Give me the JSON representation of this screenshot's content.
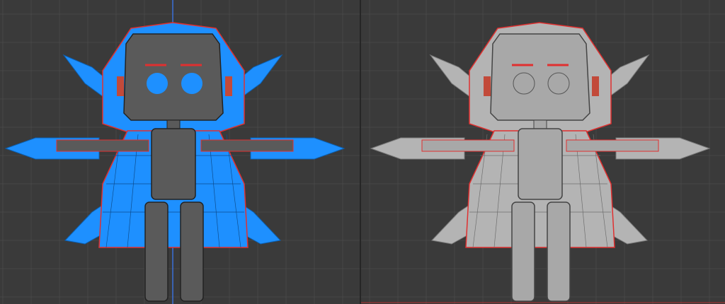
{
  "viewports": [
    {
      "id": "left",
      "shading": "x-ray",
      "fill": "#1e90ff",
      "body_fill": "#5a5a5a",
      "outline": "#e03030"
    },
    {
      "id": "right",
      "shading": "solid",
      "fill": "#b4b4b4",
      "body_fill": "#a8a8a8",
      "outline": "#e03030"
    }
  ],
  "colors": {
    "background": "#3a3a3a",
    "grid": "#474747",
    "axis_blue": "#3a6fd8",
    "axis_red": "#b03030",
    "eye": "#1e90ff"
  }
}
